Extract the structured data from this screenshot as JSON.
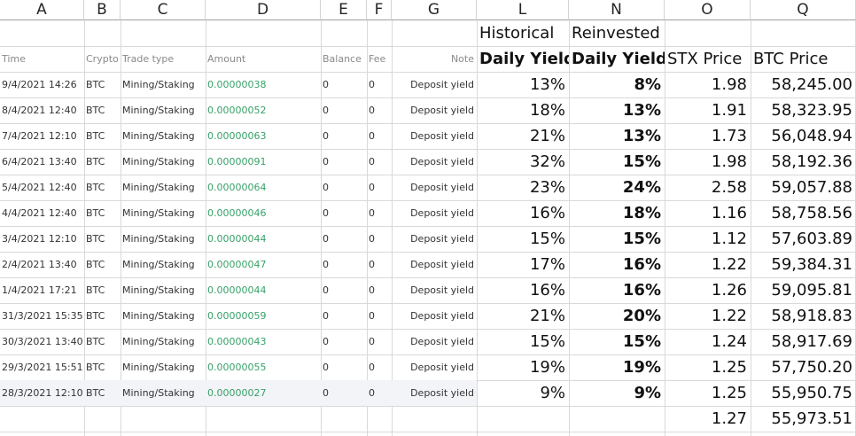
{
  "columns": [
    "A",
    "B",
    "C",
    "D",
    "E",
    "F",
    "G",
    "L",
    "N",
    "O",
    "Q"
  ],
  "header_top": {
    "L": "Historical",
    "N": "Reinvested"
  },
  "header": {
    "A": "Time",
    "B": "Crypto",
    "C": "Trade type",
    "D": "Amount",
    "E": "Balance",
    "F": "Fee",
    "G": "Note",
    "L": "Daily Yield",
    "N": "Daily Yield",
    "O": "STX Price",
    "Q": "BTC Price"
  },
  "rows": [
    {
      "A": "9/4/2021 14:26",
      "B": "BTC",
      "C": "Mining/Staking",
      "D": "0.00000038",
      "E": "0",
      "F": "0",
      "G": "Deposit yield",
      "L": "13%",
      "N": "8%",
      "O": "1.98",
      "Q": "58,245.00"
    },
    {
      "A": "8/4/2021 12:40",
      "B": "BTC",
      "C": "Mining/Staking",
      "D": "0.00000052",
      "E": "0",
      "F": "0",
      "G": "Deposit yield",
      "L": "18%",
      "N": "13%",
      "O": "1.91",
      "Q": "58,323.95"
    },
    {
      "A": "7/4/2021 12:10",
      "B": "BTC",
      "C": "Mining/Staking",
      "D": "0.00000063",
      "E": "0",
      "F": "0",
      "G": "Deposit yield",
      "L": "21%",
      "N": "13%",
      "O": "1.73",
      "Q": "56,048.94"
    },
    {
      "A": "6/4/2021 13:40",
      "B": "BTC",
      "C": "Mining/Staking",
      "D": "0.00000091",
      "E": "0",
      "F": "0",
      "G": "Deposit yield",
      "L": "32%",
      "N": "15%",
      "O": "1.98",
      "Q": "58,192.36"
    },
    {
      "A": "5/4/2021 12:40",
      "B": "BTC",
      "C": "Mining/Staking",
      "D": "0.00000064",
      "E": "0",
      "F": "0",
      "G": "Deposit yield",
      "L": "23%",
      "N": "24%",
      "O": "2.58",
      "Q": "59,057.88"
    },
    {
      "A": "4/4/2021 12:40",
      "B": "BTC",
      "C": "Mining/Staking",
      "D": "0.00000046",
      "E": "0",
      "F": "0",
      "G": "Deposit yield",
      "L": "16%",
      "N": "18%",
      "O": "1.16",
      "Q": "58,758.56"
    },
    {
      "A": "3/4/2021 12:10",
      "B": "BTC",
      "C": "Mining/Staking",
      "D": "0.00000044",
      "E": "0",
      "F": "0",
      "G": "Deposit yield",
      "L": "15%",
      "N": "15%",
      "O": "1.12",
      "Q": "57,603.89"
    },
    {
      "A": "2/4/2021 13:40",
      "B": "BTC",
      "C": "Mining/Staking",
      "D": "0.00000047",
      "E": "0",
      "F": "0",
      "G": "Deposit yield",
      "L": "17%",
      "N": "16%",
      "O": "1.22",
      "Q": "59,384.31"
    },
    {
      "A": "1/4/2021 17:21",
      "B": "BTC",
      "C": "Mining/Staking",
      "D": "0.00000044",
      "E": "0",
      "F": "0",
      "G": "Deposit yield",
      "L": "16%",
      "N": "16%",
      "O": "1.26",
      "Q": "59,095.81"
    },
    {
      "A": "31/3/2021 15:35",
      "B": "BTC",
      "C": "Mining/Staking",
      "D": "0.00000059",
      "E": "0",
      "F": "0",
      "G": "Deposit yield",
      "L": "21%",
      "N": "20%",
      "O": "1.22",
      "Q": "58,918.83"
    },
    {
      "A": "30/3/2021 13:40",
      "B": "BTC",
      "C": "Mining/Staking",
      "D": "0.00000043",
      "E": "0",
      "F": "0",
      "G": "Deposit yield",
      "L": "15%",
      "N": "15%",
      "O": "1.24",
      "Q": "58,917.69"
    },
    {
      "A": "29/3/2021 15:51",
      "B": "BTC",
      "C": "Mining/Staking",
      "D": "0.00000055",
      "E": "0",
      "F": "0",
      "G": "Deposit yield",
      "L": "19%",
      "N": "19%",
      "O": "1.25",
      "Q": "57,750.20"
    },
    {
      "A": "28/3/2021 12:10",
      "B": "BTC",
      "C": "Mining/Staking",
      "D": "0.00000027",
      "E": "0",
      "F": "0",
      "G": "Deposit yield",
      "L": "9%",
      "N": "9%",
      "O": "1.25",
      "Q": "55,950.75"
    }
  ],
  "last_row": {
    "O": "1.27",
    "Q": "55,973.51"
  },
  "colors": {
    "amount_green": "#38a169",
    "highlight_row": "#f3f4f8"
  }
}
